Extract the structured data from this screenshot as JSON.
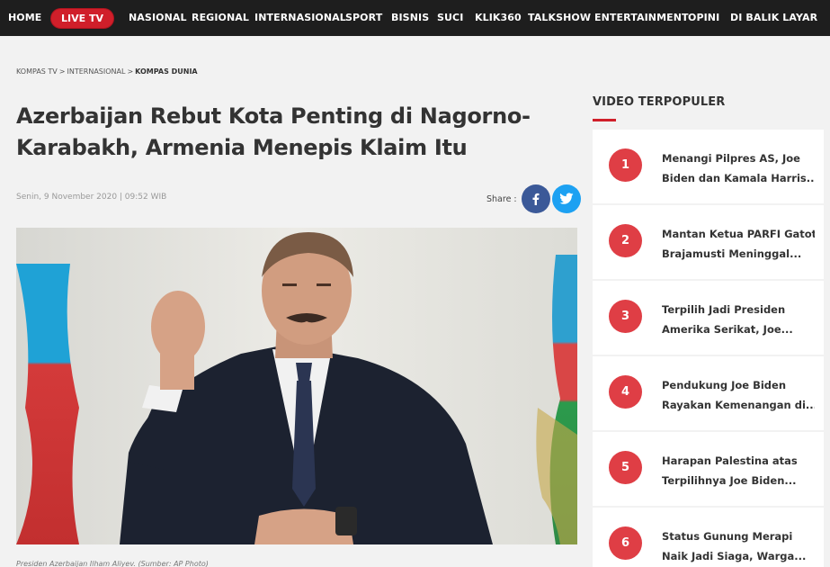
{
  "nav": {
    "home": "HOME",
    "live": "LIVE TV",
    "items": [
      "NASIONAL",
      "REGIONAL",
      "INTERNASIONAL",
      "SPORT",
      "BISNIS",
      "SUCI",
      "KLIK360",
      "TALKSHOW",
      "ENTERTAINMENT",
      "OPINI",
      "DI BALIK LAYAR"
    ]
  },
  "breadcrumb": {
    "root": "KOMPAS TV",
    "section": "INTERNASIONAL",
    "current": "KOMPAS DUNIA",
    "sep": ">"
  },
  "article": {
    "title_line1": "Azerbaijan Rebut Kota Penting di Nagorno-",
    "title_line2": "Karabakh, Armenia Menepis Klaim Itu",
    "date": "Senin, 9 November 2020 | 09:52 WIB",
    "share_label": "Share :",
    "caption": "Presiden Azerbaijan Ilham Aliyev. (Sumber: AP Photo)"
  },
  "sidebar": {
    "title": "VIDEO TERPOPULER",
    "items": [
      {
        "num": "1",
        "line1": "Menangi Pilpres AS, Joe",
        "line2": "Biden dan Kamala Harris..."
      },
      {
        "num": "2",
        "line1": "Mantan Ketua PARFI Gatot",
        "line2": "Brajamusti Meninggal..."
      },
      {
        "num": "3",
        "line1": "Terpilih Jadi Presiden",
        "line2": "Amerika Serikat, Joe..."
      },
      {
        "num": "4",
        "line1": "Pendukung Joe Biden",
        "line2": "Rayakan Kemenangan di..."
      },
      {
        "num": "5",
        "line1": "Harapan Palestina atas",
        "line2": "Terpilihnya Joe Biden..."
      },
      {
        "num": "6",
        "line1": "Status Gunung Merapi",
        "line2": "Naik Jadi Siaga, Warga..."
      }
    ]
  },
  "colors": {
    "nav_bg": "#1e1e1e",
    "accent_red": "#d01f2a",
    "rank_red": "#df3e45",
    "facebook": "#3b5998",
    "twitter": "#1da1f2"
  }
}
